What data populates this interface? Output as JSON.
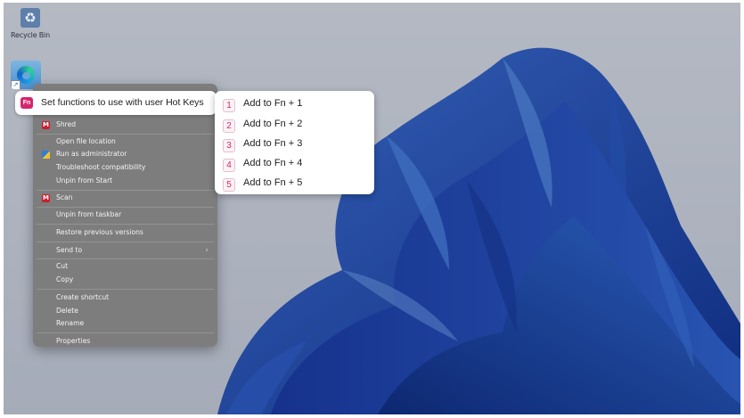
{
  "desktop": {
    "recycle_bin_label": "Recycle Bin"
  },
  "context_menu": {
    "hotkey_badge": "Fn",
    "hotkey_item": "Set functions to use with user Hot Keys",
    "items": [
      {
        "label": "Shred",
        "icon": "mcafee-icon"
      },
      {
        "label": "Open file location"
      },
      {
        "label": "Run as administrator",
        "icon": "shield-icon"
      },
      {
        "label": "Troubleshoot compatibility"
      },
      {
        "label": "Unpin from Start"
      },
      {
        "label": "Scan",
        "icon": "mcafee-icon"
      },
      {
        "label": "Unpin from taskbar"
      },
      {
        "label": "Restore previous versions"
      },
      {
        "label": "Send to",
        "submenu_arrow": "›"
      },
      {
        "label": "Cut"
      },
      {
        "label": "Copy"
      },
      {
        "label": "Create shortcut"
      },
      {
        "label": "Delete"
      },
      {
        "label": "Rename"
      },
      {
        "label": "Properties"
      }
    ]
  },
  "submenu": {
    "items": [
      {
        "number": "1",
        "label": "Add to Fn + 1"
      },
      {
        "number": "2",
        "label": "Add to Fn + 2"
      },
      {
        "number": "3",
        "label": "Add to Fn + 3"
      },
      {
        "number": "4",
        "label": "Add to Fn + 4"
      },
      {
        "number": "5",
        "label": "Add to Fn + 5"
      }
    ]
  },
  "colors": {
    "fn_accent": "#d6246e",
    "menu_background": "#7d7d7d",
    "wallpaper_blue": "#1f4fc7"
  }
}
